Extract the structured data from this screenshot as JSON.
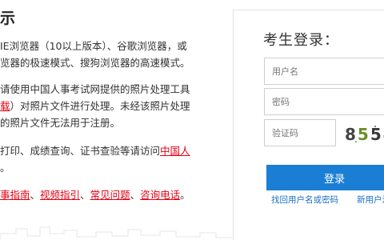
{
  "notice": {
    "title": "示",
    "p1_line1": "IE浏览器（10以上版本）、谷歌浏览器，或",
    "p1_line2": "览器的极速模式、搜狗浏览器的高速模式。",
    "p2_line1": "请使用中国人事考试网提供的照片处理工具",
    "p2_line2_link": "载",
    "p2_line2_text": "）对照片文件进行处理。未经该照片处理",
    "p2_line3": "的照片文件无法用于注册。",
    "p3_line1_text": "打印、成绩查询、证书查验等请访问",
    "p3_line1_link": "中国人",
    "p3_line2": "。",
    "p4_links": [
      "事指南",
      "视频指引",
      "常见问题",
      "咨询电话"
    ],
    "p4_sep": "、",
    "p4_end": "。"
  },
  "login": {
    "title": "考生登录：",
    "username_placeholder": "用户名",
    "password_placeholder": "密码",
    "captcha_placeholder": "验证码",
    "captcha_text": "8554",
    "login_label": "登录",
    "forgot_label": "找回用户名或密码",
    "register_label": "新用户注册"
  },
  "colors": {
    "accent": "#1a7fd4",
    "link_red": "#e60012",
    "link_blue": "#1a6fc4"
  }
}
